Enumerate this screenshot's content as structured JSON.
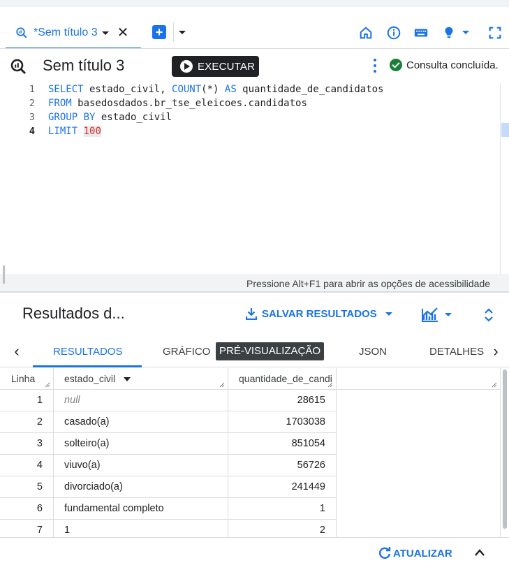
{
  "tabs": {
    "active_tab_label": "*Sem título 3"
  },
  "title": "Sem título 3",
  "run_button_label": "EXECUTAR",
  "status_text": "Consulta concluída.",
  "editor": {
    "line_numbers": [
      "1",
      "2",
      "3",
      "4"
    ],
    "lines": [
      [
        {
          "t": "SELECT",
          "c": "kw"
        },
        {
          "t": " estado_civil, ",
          "c": ""
        },
        {
          "t": "COUNT",
          "c": "kw"
        },
        {
          "t": "(*) ",
          "c": ""
        },
        {
          "t": "AS",
          "c": "kw"
        },
        {
          "t": " quantidade_de_candidatos",
          "c": ""
        }
      ],
      [
        {
          "t": "FROM",
          "c": "kw"
        },
        {
          "t": " basedosdados.br_tse_eleicoes.candidatos",
          "c": ""
        }
      ],
      [
        {
          "t": "GROUP BY",
          "c": "kw"
        },
        {
          "t": " estado_civil",
          "c": ""
        }
      ],
      [
        {
          "t": "LIMIT",
          "c": "kw"
        },
        {
          "t": " ",
          "c": ""
        },
        {
          "t": "100",
          "c": "num"
        }
      ]
    ]
  },
  "accessibility_hint": "Pressione Alt+F1 para abrir as opções de acessibilidade",
  "results": {
    "title": "Resultados d...",
    "save_label": "SALVAR RESULTADOS",
    "tabs": {
      "resultados": "RESULTADOS",
      "grafico": "GRÁFICO",
      "previsualizacao": "PRÉ-VISUALIZAÇÃO",
      "json": "JSON",
      "detalhes": "DETALHES"
    },
    "columns": {
      "line": "Linha",
      "estado": "estado_civil",
      "qtd": "quantidade_de_candi"
    },
    "rows": [
      {
        "line": "1",
        "estado": "null",
        "qtd": "28615",
        "is_null": true
      },
      {
        "line": "2",
        "estado": "casado(a)",
        "qtd": "1703038"
      },
      {
        "line": "3",
        "estado": "solteiro(a)",
        "qtd": "851054"
      },
      {
        "line": "4",
        "estado": "viuvo(a)",
        "qtd": "56726"
      },
      {
        "line": "5",
        "estado": "divorciado(a)",
        "qtd": "241449"
      },
      {
        "line": "6",
        "estado": "fundamental completo",
        "qtd": "1"
      },
      {
        "line": "7",
        "estado": "1",
        "qtd": "2"
      }
    ]
  },
  "footer": {
    "refresh_label": "ATUALIZAR"
  },
  "colors": {
    "accent": "#1a73e8",
    "success": "#188038",
    "dark_button": "#202124"
  }
}
